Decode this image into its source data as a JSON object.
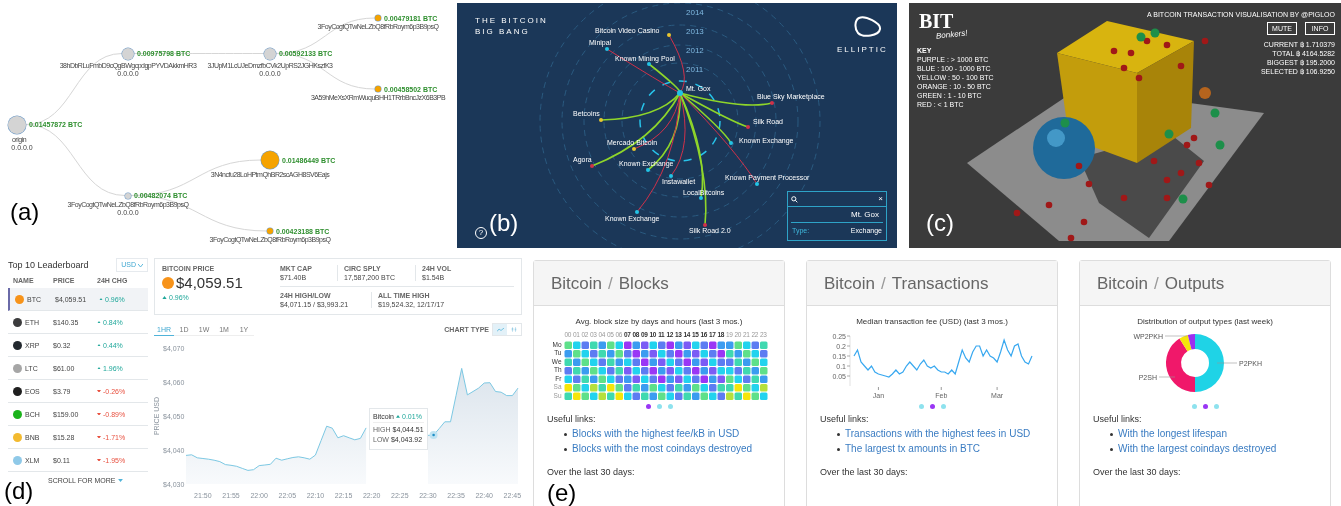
{
  "panel_a": {
    "label": "(a)",
    "tree": {
      "amount": "0.01457872 BTC",
      "address": "origin",
      "ip": "0.0.0.0",
      "color": "#d4d4d4",
      "children": [
        {
          "amount": "0.00975798 BTC",
          "address": "38hDbRLuFmbD9cQgBWgcpdgpPYVDAkkmHR3",
          "ip": "0.0.0.0",
          "color": "#d4d4d4",
          "children": [
            {
              "amount": "0.00592133 BTC",
              "address": "3JUpM1LcUJeDmzfbCVk2UpRS2JGHKszfK3",
              "ip": "0.0.0.0",
              "color": "#d4d4d4",
              "children": [
                {
                  "amount": "0.00479181 BTC",
                  "address": "3FoyCogtQTwNeLZbQ8fRbRoym6p3B9psQ",
                  "color": "#f5a300"
                },
                {
                  "amount": "0.00458502 BTC",
                  "address": "3A59hMeXsXRmWuquBHH1TRrbBncJzX6B3PB",
                  "color": "#f5a300"
                }
              ]
            }
          ]
        },
        {
          "amount": "0.00482074 BTC",
          "address": "3FoyCogtQTwNeLZbQ8fRbRoym6p3B9psQ",
          "ip": "0.0.0.0",
          "color": "#d4d4d4",
          "children": [
            {
              "amount": "0.01486449 BTC",
              "address": "3N4ncfu28LoHPtmQhBR2scAGH8SV6Eajs",
              "color": "#f5a300"
            },
            {
              "amount": "0.00423188 BTC",
              "address": "3FoyCogtQTwNeLZbQ8fRbRoym6p3B9psQ",
              "color": "#f5a300"
            }
          ]
        }
      ]
    }
  },
  "panel_b": {
    "label": "(b)",
    "title": "THE BITCOIN BIG BANG",
    "brand": "ELLIPTIC",
    "help": "?",
    "years": [
      "2014",
      "2013",
      "2012",
      "2011"
    ],
    "nodes": [
      {
        "name": "Bitcoin Video Casino",
        "color": "#e8c630"
      },
      {
        "name": "Minipal",
        "color": "#22c3e6"
      },
      {
        "name": "Known Mining Pool",
        "color": "#22c3e6"
      },
      {
        "name": "Mt. Gox",
        "color": "#22c3e6"
      },
      {
        "name": "Blue Sky Marketplace",
        "color": "#d0314a"
      },
      {
        "name": "Betcoins",
        "color": "#e8c630"
      },
      {
        "name": "Silk Road",
        "color": "#d0314a"
      },
      {
        "name": "Mercado Bitcoin",
        "color": "#e8c630"
      },
      {
        "name": "Known Exchange",
        "color": "#22c3e6"
      },
      {
        "name": "Agora",
        "color": "#d0314a"
      },
      {
        "name": "Known Exchange",
        "color": "#22c3e6"
      },
      {
        "name": "Instawallet",
        "color": "#22c3e6"
      },
      {
        "name": "Known Payment Processor",
        "color": "#22c3e6"
      },
      {
        "name": "LocalBitcoins",
        "color": "#22c3e6"
      },
      {
        "name": "Known Exchange",
        "color": "#22c3e6"
      },
      {
        "name": "Silk Road 2.0",
        "color": "#d0314a"
      }
    ],
    "search": {
      "clear": "×",
      "name": "Mt. Gox",
      "type_label": "Type:",
      "type_value": "Exchange"
    }
  },
  "panel_c": {
    "label": "(c)",
    "logo": "BIT",
    "logo_sub": "Bonkers!",
    "credit": "A BITCOIN TRANSACTION VISUALISATION BY @PIGLOO",
    "buttons": [
      "MUTE",
      "INFO"
    ],
    "key_title": "KEY",
    "key": [
      "PURPLE : > 1000 BTC",
      "BLUE : 100 - 1000 BTC",
      "YELLOW : 50 - 100 BTC",
      "ORANGE : 10 - 50 BTC",
      "GREEN : 1 - 10 BTC",
      "RED : < 1 BTC"
    ],
    "stats": [
      "CURRENT ฿ 1.710379",
      "TOTAL ฿ 4164.5282",
      "BIGGEST ฿ 195.2000",
      "SELECTED ฿ 106.9250"
    ]
  },
  "panel_d": {
    "label": "(d)",
    "title": "Top 10 Leaderboard",
    "currency": "USD",
    "columns": [
      "NAME",
      "PRICE",
      "24H CHG"
    ],
    "rows": [
      {
        "symbol": "BTC",
        "price": "$4,059.51",
        "change": "0.96%",
        "rising": true,
        "color": "#f7931a",
        "selected": true
      },
      {
        "symbol": "ETH",
        "price": "$140.35",
        "change": "0.84%",
        "rising": true,
        "color": "#3c3c3d",
        "selected": false
      },
      {
        "symbol": "XRP",
        "price": "$0.32",
        "change": "0.44%",
        "rising": true,
        "color": "#23292f",
        "selected": false
      },
      {
        "symbol": "LTC",
        "price": "$61.00",
        "change": "1.96%",
        "rising": true,
        "color": "#a6a6a6",
        "selected": false
      },
      {
        "symbol": "EOS",
        "price": "$3.79",
        "change": "-0.26%",
        "rising": false,
        "color": "#1f1f1f",
        "selected": false
      },
      {
        "symbol": "BCH",
        "price": "$159.00",
        "change": "-0.89%",
        "rising": false,
        "color": "#1bb31b",
        "selected": false
      },
      {
        "symbol": "BNB",
        "price": "$15.28",
        "change": "-1.71%",
        "rising": false,
        "color": "#f3ba2f",
        "selected": false
      },
      {
        "symbol": "XLM",
        "price": "$0.11",
        "change": "-1.95%",
        "rising": false,
        "color": "#8fc9e8",
        "selected": false
      }
    ],
    "scroll_hint": "SCROLL FOR MORE",
    "price_label": "BITCOIN PRICE",
    "price": "$4,059.51",
    "price_change": "0.96%",
    "stats": [
      {
        "label": "MKT CAP",
        "value": "$71.40B"
      },
      {
        "label": "CIRC SPLY",
        "value": "17,587,200 BTC"
      },
      {
        "label": "24H VOL",
        "value": "$1.54B"
      },
      {
        "label": "24H HIGH/LOW",
        "value": "$4,071.15 / $3,993.21"
      },
      {
        "label": "ALL TIME HIGH",
        "value": "$19,524.32, 12/17/17"
      }
    ],
    "ranges": [
      {
        "label": "1HR",
        "selected": true
      },
      {
        "label": "1D",
        "selected": false
      },
      {
        "label": "1W",
        "selected": false
      },
      {
        "label": "1M",
        "selected": false
      },
      {
        "label": "1Y",
        "selected": false
      }
    ],
    "chart_type_label": "CHART TYPE",
    "chart_types": [
      {
        "kind": "line",
        "selected": true
      },
      {
        "kind": "candle",
        "selected": false
      }
    ],
    "tooltip": {
      "change": "0.01%",
      "high_label": "HIGH",
      "high": "$4,044.51",
      "low_label": "LOW",
      "low": "$4,043.92"
    },
    "chart_data": {
      "type": "area",
      "ylabel": "PRICE USD",
      "categories": [
        null,
        null,
        null,
        "21:50",
        null,
        null,
        null,
        null,
        "21:55",
        null,
        null,
        null,
        null,
        "22:00",
        null,
        null,
        null,
        null,
        "22:05",
        null,
        null,
        null,
        null,
        "22:10",
        null,
        null,
        null,
        null,
        "22:15",
        null,
        null,
        null,
        null,
        "22:20",
        null,
        null,
        null,
        null,
        "22:25",
        null,
        null,
        null,
        null,
        "22:30",
        null,
        null,
        null,
        null,
        "22:35",
        null,
        null,
        null,
        null,
        "22:40",
        null,
        null,
        null,
        null,
        "22:45",
        null
      ],
      "series": [
        {
          "name": "Bitcoin",
          "color": "#7cc8e3",
          "values": [
            4038.4,
            4038.6,
            4037.7,
            4037.5,
            4037.3,
            4037.0,
            4036.6,
            4035.7,
            4035.5,
            4035.2,
            4034.6,
            4034.0,
            4034.2,
            4035.4,
            4035.6,
            4035.8,
            4037.6,
            4037.0,
            4037.4,
            4037.8,
            4038.0,
            4037.7,
            4037.3,
            4038.5,
            4042.8,
            4047.0,
            4046.4,
            4043.6,
            4044.2,
            4043.6,
            4043.0,
            4043.4,
            4046.5,
            null,
            null,
            null,
            null,
            null,
            null,
            null,
            null,
            null,
            null,
            4044.3,
            4044.4,
            4046.3,
            4048.3,
            4048.3,
            4056.1,
            4064.0,
            4056.2,
            4057.2,
            4058.2,
            4059.7,
            4059.8,
            4057.2,
            4057.0,
            4056.0,
            4056.0,
            4058.2
          ]
        }
      ],
      "ylim": [
        4030,
        4070
      ],
      "yticks": [
        {
          "value": 4030,
          "label": "$4,030"
        },
        {
          "value": 4040,
          "label": "$4,040"
        },
        {
          "value": 4050,
          "label": "$4,050"
        },
        {
          "value": 4060,
          "label": "$4,060"
        },
        {
          "value": 4070,
          "label": "$4,070"
        }
      ]
    }
  },
  "panel_e": {
    "label": "(e)",
    "separator": "/",
    "cards": [
      {
        "kind": "heatmap",
        "crumbs": [
          "Bitcoin",
          "Blocks"
        ],
        "chart_title": "Avg. block size by days and hours (last 3 mos.)",
        "hours": [
          {
            "label": "00",
            "highlighted": false
          },
          {
            "label": "01",
            "highlighted": false
          },
          {
            "label": "02",
            "highlighted": false
          },
          {
            "label": "03",
            "highlighted": false
          },
          {
            "label": "04",
            "highlighted": false
          },
          {
            "label": "05",
            "highlighted": false
          },
          {
            "label": "06",
            "highlighted": false
          },
          {
            "label": "07",
            "highlighted": true
          },
          {
            "label": "08",
            "highlighted": true
          },
          {
            "label": "09",
            "highlighted": true
          },
          {
            "label": "10",
            "highlighted": true
          },
          {
            "label": "11",
            "highlighted": true
          },
          {
            "label": "12",
            "highlighted": true
          },
          {
            "label": "13",
            "highlighted": true
          },
          {
            "label": "14",
            "highlighted": true
          },
          {
            "label": "15",
            "highlighted": true
          },
          {
            "label": "16",
            "highlighted": true
          },
          {
            "label": "17",
            "highlighted": true
          },
          {
            "label": "18",
            "highlighted": true
          },
          {
            "label": "19",
            "highlighted": false
          },
          {
            "label": "20",
            "highlighted": false
          },
          {
            "label": "21",
            "highlighted": false
          },
          {
            "label": "22",
            "highlighted": false
          },
          {
            "label": "23",
            "highlighted": false
          }
        ],
        "days": [
          {
            "label": "Mo",
            "highlighted": true
          },
          {
            "label": "Tu",
            "highlighted": true
          },
          {
            "label": "We",
            "highlighted": true
          },
          {
            "label": "Th",
            "highlighted": true
          },
          {
            "label": "Fr",
            "highlighted": true
          },
          {
            "label": "Sa",
            "highlighted": false
          },
          {
            "label": "Su",
            "highlighted": false
          }
        ],
        "dots": [
          {
            "selected": true
          },
          {
            "selected": false
          },
          {
            "selected": false
          }
        ],
        "links_title": "Useful links:",
        "links": [
          "Blocks with the highest fee/kB in USD",
          "Blocks with the most coindays destroyed"
        ],
        "footer": "Over the last 30 days:"
      },
      {
        "kind": "line",
        "crumbs": [
          "Bitcoin",
          "Transactions"
        ],
        "chart_title": "Median transaction fee (USD) (last 3 mos.)",
        "chart_data": {
          "type": "line",
          "categories": [
            null,
            null,
            null,
            null,
            null,
            null,
            null,
            "Jan",
            null,
            null,
            null,
            null,
            null,
            null,
            null,
            null,
            null,
            null,
            null,
            null,
            null,
            null,
            null,
            null,
            null,
            "Feb",
            null,
            null,
            null,
            null,
            null,
            null,
            null,
            null,
            null,
            null,
            null,
            null,
            null,
            null,
            null,
            "Mar",
            null,
            null,
            null,
            null,
            null,
            null,
            null,
            null,
            null,
            null
          ],
          "series": [
            {
              "color": "#38a8f0",
              "values": [
                0.15,
                0.18,
                0.12,
                0.1,
                0.08,
                0.1,
                0.07,
                0.06,
                0.055,
                0.05,
                0.045,
                0.06,
                0.08,
                0.06,
                0.07,
                0.1,
                0.12,
                0.1,
                0.08,
                0.11,
                0.13,
                0.1,
                0.09,
                0.1,
                0.08,
                0.07,
                0.07,
                0.06,
                0.08,
                0.06,
                0.12,
                0.18,
                0.14,
                0.12,
                0.17,
                0.2,
                0.2,
                0.15,
                0.18,
                0.15,
                0.14,
                0.12,
                0.17,
                0.23,
                0.18,
                0.15,
                0.2,
                0.21,
                0.15,
                0.12,
                0.11,
                0.15
              ]
            }
          ],
          "ylim": [
            0,
            0.25
          ],
          "yticks": [
            {
              "value": 0.05,
              "label": "0.05"
            },
            {
              "value": 0.1,
              "label": "0.1"
            },
            {
              "value": 0.15,
              "label": "0.15"
            },
            {
              "value": 0.2,
              "label": "0.2"
            },
            {
              "value": 0.25,
              "label": "0.25"
            }
          ]
        },
        "dots": [
          {
            "selected": false
          },
          {
            "selected": true
          },
          {
            "selected": false
          }
        ],
        "links_title": "Useful links:",
        "links": [
          "Transactions with the highest fees in USD",
          "The largest tx amounts in BTC"
        ],
        "footer": "Over the last 30 days:"
      },
      {
        "kind": "donut",
        "crumbs": [
          "Bitcoin",
          "Outputs"
        ],
        "chart_title": "Distribution of output types (last week)",
        "slices": [
          {
            "label": "P2PKH",
            "color": "#1fd3e6"
          },
          {
            "label": "P2SH",
            "color": "#f0186a"
          },
          {
            "label": "WP2PKH",
            "color": "#f5e50a"
          },
          {
            "color": "#9b30f0"
          }
        ],
        "dots": [
          {
            "selected": false
          },
          {
            "selected": true
          },
          {
            "selected": false
          }
        ],
        "links_title": "Useful links:",
        "links": [
          "With the longest lifespan",
          "With the largest coindays destroyed"
        ],
        "footer": "Over the last 30 days:"
      }
    ]
  }
}
